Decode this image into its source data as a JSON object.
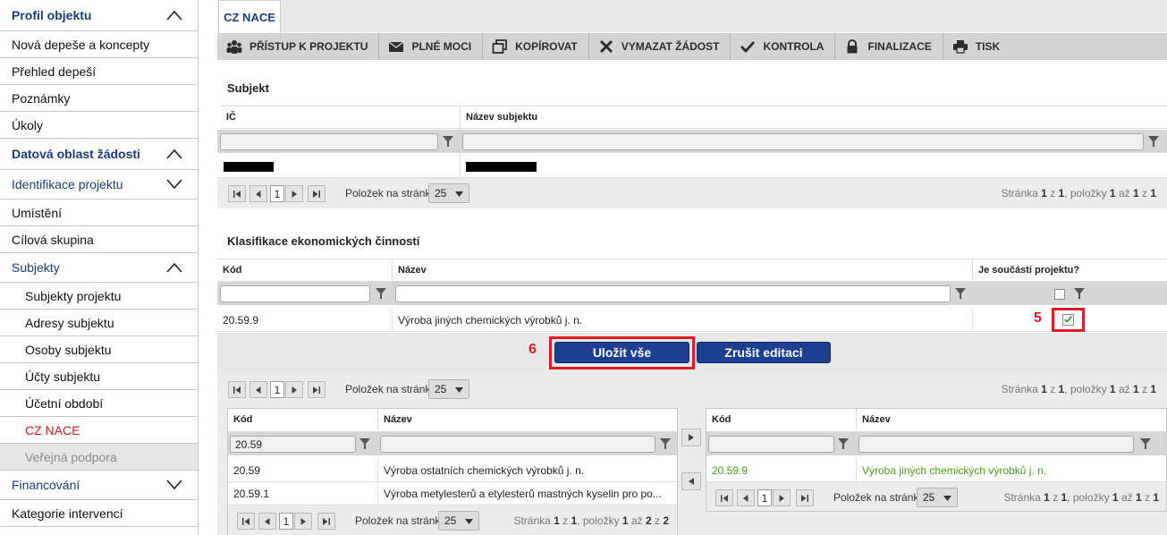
{
  "sidebar": {
    "items": [
      {
        "label": "Profil objektu"
      },
      {
        "label": "Nová depeše a koncepty"
      },
      {
        "label": "Přehled depeší"
      },
      {
        "label": "Poznámky"
      },
      {
        "label": "Úkoly"
      },
      {
        "label": "Datová oblast žádosti"
      },
      {
        "label": "Identifikace projektu"
      },
      {
        "label": "Umístění"
      },
      {
        "label": "Cílová skupina"
      },
      {
        "label": "Subjekty"
      },
      {
        "label": "Subjekty projektu"
      },
      {
        "label": "Adresy subjektu"
      },
      {
        "label": "Osoby subjektu"
      },
      {
        "label": "Účty subjektu"
      },
      {
        "label": "Účetní období"
      },
      {
        "label": "CZ NACE"
      },
      {
        "label": "Veřejná podpora"
      },
      {
        "label": "Financování"
      },
      {
        "label": "Kategorie intervencí"
      }
    ]
  },
  "tabs": {
    "active": "CZ NACE"
  },
  "toolbar": {
    "access": "PŘÍSTUP K PROJEKTU",
    "powers": "PLNÉ MOCI",
    "copy": "KOPÍROVAT",
    "delete": "VYMAZAT ŽÁDOST",
    "check": "KONTROLA",
    "finalize": "FINALIZACE",
    "print": "TISK"
  },
  "subjekt": {
    "title": "Subjekt",
    "col_ic": "IČ",
    "col_name": "Název subjektu"
  },
  "pager": {
    "page": "1",
    "per_page_label": "Položek na stránku",
    "per_page": "25",
    "info_a": "Stránka ",
    "info_b": "1",
    "info_c": " z ",
    "info_d": "1",
    "info_e": ", položky ",
    "info_f": "1",
    "info_g": " až ",
    "info_h": "1",
    "info_i": " z ",
    "info_j": "1",
    "info2_h": "2",
    "info2_j": "2"
  },
  "klasifikace": {
    "title": "Klasifikace ekonomických činností",
    "col_code": "Kód",
    "col_name": "Název",
    "col_part": "Je součástí projektu?",
    "row_code": "20.59.9",
    "row_name": "Výroba jiných chemických výrobků j. n.",
    "row_checked": true
  },
  "annotations": {
    "n5": "5",
    "n6": "6"
  },
  "actions": {
    "save": "Uložit vše",
    "cancel": "Zrušit editaci"
  },
  "left_table": {
    "col_code": "Kód",
    "col_name": "Název",
    "filter_code": "20.59",
    "rows": [
      {
        "code": "20.59",
        "name": "Výroba ostatních chemických výrobků j. n."
      },
      {
        "code": "20.59.1",
        "name": "Výroba metylesterů a etylesterů mastných kyselin pro po..."
      }
    ]
  },
  "right_table": {
    "col_code": "Kód",
    "col_name": "Název",
    "rows": [
      {
        "code": "20.59.9",
        "name": "Výroba jiných chemických výrobků j. n."
      }
    ]
  },
  "colors": {
    "accent": "#1c3f92",
    "highlight": "#e01b22",
    "selected_text": "#4a9a18"
  }
}
